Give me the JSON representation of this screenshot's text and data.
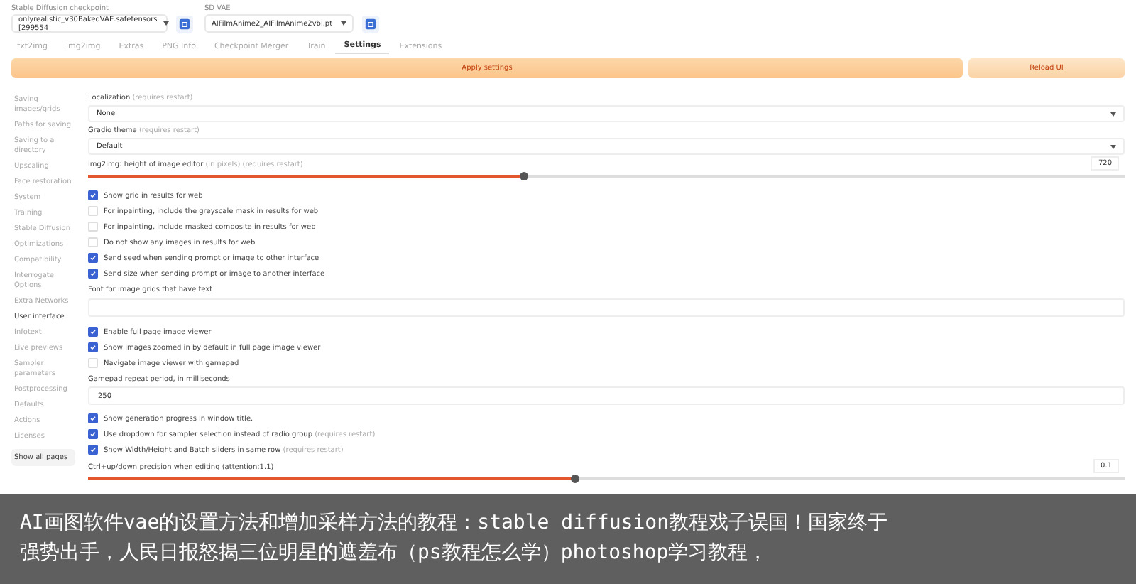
{
  "header": {
    "checkpoint": {
      "label": "Stable Diffusion checkpoint",
      "value": "onlyrealistic_v30BakedVAE.safetensors [299554"
    },
    "vae": {
      "label": "SD VAE",
      "value": "AIFilmAnime2_AIFilmAnime2vbl.pt"
    }
  },
  "tabs": [
    {
      "label": "txt2img",
      "selected": false
    },
    {
      "label": "img2img",
      "selected": false
    },
    {
      "label": "Extras",
      "selected": false
    },
    {
      "label": "PNG Info",
      "selected": false
    },
    {
      "label": "Checkpoint Merger",
      "selected": false
    },
    {
      "label": "Train",
      "selected": false
    },
    {
      "label": "Settings",
      "selected": true
    },
    {
      "label": "Extensions",
      "selected": false
    }
  ],
  "actions": {
    "apply": "Apply settings",
    "reload": "Reload UI"
  },
  "sidebar": {
    "items": [
      {
        "label": "Saving images/grids",
        "selected": false
      },
      {
        "label": "Paths for saving",
        "selected": false
      },
      {
        "label": "Saving to a directory",
        "selected": false
      },
      {
        "label": "Upscaling",
        "selected": false
      },
      {
        "label": "Face restoration",
        "selected": false
      },
      {
        "label": "System",
        "selected": false
      },
      {
        "label": "Training",
        "selected": false
      },
      {
        "label": "Stable Diffusion",
        "selected": false
      },
      {
        "label": "Optimizations",
        "selected": false
      },
      {
        "label": "Compatibility",
        "selected": false
      },
      {
        "label": "Interrogate Options",
        "selected": false
      },
      {
        "label": "Extra Networks",
        "selected": false
      },
      {
        "label": "User interface",
        "selected": true
      },
      {
        "label": "Infotext",
        "selected": false
      },
      {
        "label": "Live previews",
        "selected": false
      },
      {
        "label": "Sampler parameters",
        "selected": false
      },
      {
        "label": "Postprocessing",
        "selected": false
      },
      {
        "label": "Defaults",
        "selected": false
      },
      {
        "label": "Actions",
        "selected": false
      },
      {
        "label": "Licenses",
        "selected": false
      }
    ],
    "show_all": "Show all pages"
  },
  "settings": [
    {
      "kind": "select",
      "label": "Localization",
      "note": "(requires restart)",
      "value": "None"
    },
    {
      "kind": "select",
      "label": "Gradio theme",
      "note": "(requires restart)",
      "value": "Default"
    },
    {
      "kind": "slider",
      "label": "img2img: height of image editor",
      "note": "(in pixels) (requires restart)",
      "value": "720",
      "level": 0.42
    },
    {
      "kind": "checkbox",
      "label": "Show grid in results for web",
      "checked": true
    },
    {
      "kind": "checkbox",
      "label": "For inpainting, include the greyscale mask in results for web",
      "checked": false
    },
    {
      "kind": "checkbox",
      "label": "For inpainting, include masked composite in results for web",
      "checked": false
    },
    {
      "kind": "checkbox",
      "label": "Do not show any images in results for web",
      "checked": false
    },
    {
      "kind": "checkbox",
      "label": "Send seed when sending prompt or image to other interface",
      "checked": true
    },
    {
      "kind": "checkbox",
      "label": "Send size when sending prompt or image to another interface",
      "checked": true
    },
    {
      "kind": "textarea",
      "label": "Font for image grids that have text"
    },
    {
      "kind": "checkbox",
      "label": "Enable full page image viewer",
      "checked": true
    },
    {
      "kind": "checkbox",
      "label": "Show images zoomed in by default in full page image viewer",
      "checked": true
    },
    {
      "kind": "checkbox",
      "label": "Navigate image viewer with gamepad",
      "checked": false
    },
    {
      "kind": "number",
      "label": "Gamepad repeat period, in milliseconds",
      "value": "250"
    },
    {
      "kind": "checkbox",
      "label": "Show generation progress in window title.",
      "checked": true
    },
    {
      "kind": "checkbox",
      "label": "Use dropdown for sampler selection instead of radio group",
      "note": "(requires restart)",
      "checked": true
    },
    {
      "kind": "checkbox",
      "label": "Show Width/Height and Batch sliders in same row",
      "note": "(requires restart)",
      "checked": true
    },
    {
      "kind": "slider",
      "label": "Ctrl+up/down precision when editing (attention:1.1)",
      "value": "0.1",
      "level": 0.47
    }
  ],
  "caption": [
    "AI画图软件vae的设置方法和增加采样方法的教程：stable diffusion教程戏子误国！国家终于",
    "强势出手，人民日报怒揭三位明星的遮羞布（ps教程怎么学）photoshop学习教程，"
  ]
}
